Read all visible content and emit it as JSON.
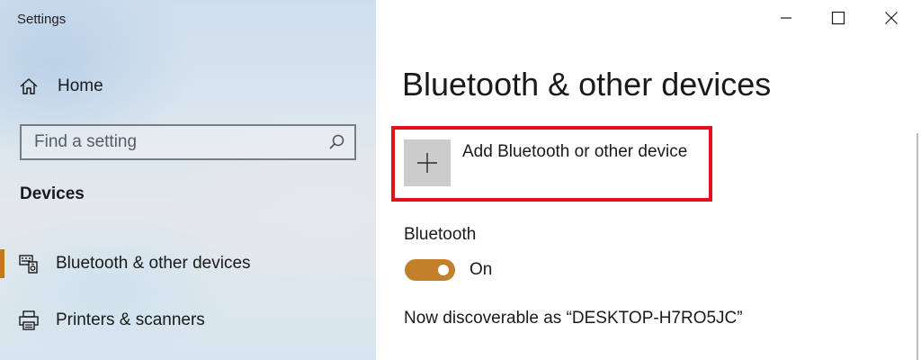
{
  "window": {
    "title": "Settings",
    "controls": {
      "minimize": "minimize-icon",
      "maximize": "maximize-icon",
      "close": "close-icon"
    }
  },
  "sidebar": {
    "home_label": "Home",
    "search": {
      "placeholder": "Find a setting",
      "value": ""
    },
    "section_heading": "Devices",
    "items": [
      {
        "label": "Bluetooth & other devices",
        "icon": "bluetooth-devices-icon",
        "selected": true
      },
      {
        "label": "Printers & scanners",
        "icon": "printer-icon",
        "selected": false
      }
    ]
  },
  "main": {
    "page_title": "Bluetooth & other devices",
    "add_device_label": "Add Bluetooth or other device",
    "bluetooth": {
      "label": "Bluetooth",
      "toggle_state": "On",
      "discoverable_text": "Now discoverable as “DESKTOP-H7RO5JC”"
    }
  },
  "colors": {
    "accent": "#c47f2a",
    "selection_indicator": "#c07a1e",
    "highlight_box": "#e3121d",
    "plus_tile": "#cccccc"
  }
}
